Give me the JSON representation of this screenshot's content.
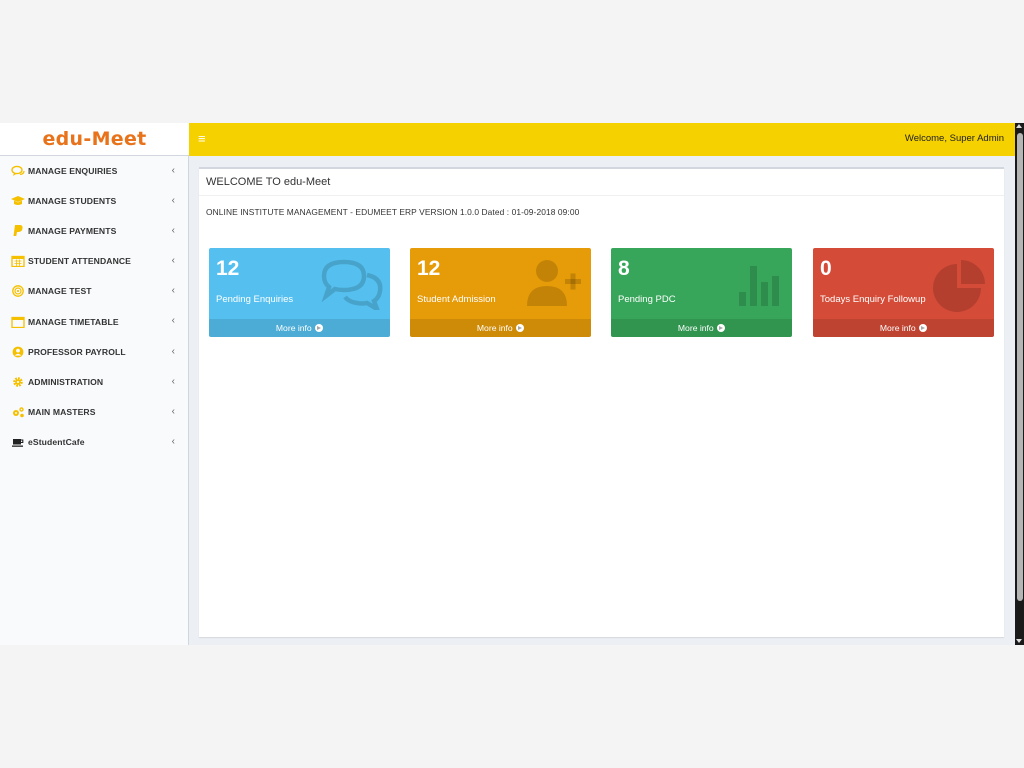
{
  "header": {
    "logo_text": "edu-Meet",
    "menu_icon": "hamburger-icon",
    "welcome_text": "Welcome, Super Admin"
  },
  "sidebar": {
    "items": [
      {
        "label": "MANAGE ENQUIRIES",
        "icon": "comments-icon"
      },
      {
        "label": "MANAGE STUDENTS",
        "icon": "graduation-cap-icon"
      },
      {
        "label": "MANAGE PAYMENTS",
        "icon": "paypal-icon"
      },
      {
        "label": "STUDENT ATTENDANCE",
        "icon": "calendar-icon"
      },
      {
        "label": "MANAGE TEST",
        "icon": "target-icon"
      },
      {
        "label": "MANAGE TIMETABLE",
        "icon": "calendar-blank-icon"
      },
      {
        "label": "PROFESSOR PAYROLL",
        "icon": "user-circle-icon"
      },
      {
        "label": "ADMINISTRATION",
        "icon": "gear-icon"
      },
      {
        "label": "MAIN MASTERS",
        "icon": "gears-icon"
      },
      {
        "label": "eStudentCafe",
        "icon": "coffee-icon"
      }
    ]
  },
  "main": {
    "title": "WELCOME TO edu-Meet",
    "subtitle": "ONLINE INSTITUTE MANAGEMENT - EDUMEET ERP VERSION 1.0.0 Dated : 01-09-2018 09:00",
    "tiles": [
      {
        "value": "12",
        "label": "Pending Enquiries",
        "footer": "More info",
        "color": "#55c0ef",
        "icon": "comments-icon"
      },
      {
        "value": "12",
        "label": "Student Admission",
        "footer": "More info",
        "color": "#e69b09",
        "icon": "user-plus-icon"
      },
      {
        "value": "8",
        "label": "Pending PDC",
        "footer": "More info",
        "color": "#37a65a",
        "icon": "bar-chart-icon"
      },
      {
        "value": "0",
        "label": "Todays Enquiry Followup",
        "footer": "More info",
        "color": "#d44b37",
        "icon": "pie-chart-icon"
      }
    ]
  },
  "colors": {
    "topbar": "#f5d100",
    "logo": "#e8731a",
    "sidebar_icon": "#f5c000"
  }
}
